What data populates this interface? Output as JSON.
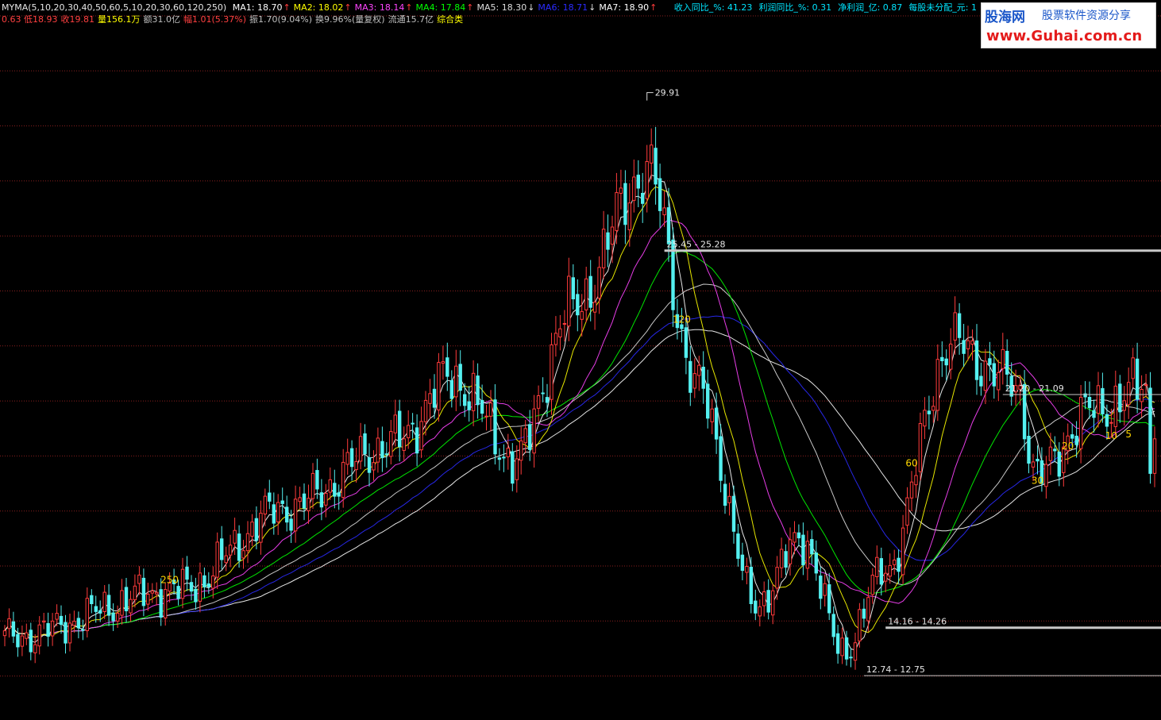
{
  "indicator_header": {
    "name": "MYMA(5,10,20,30,40,50,60,5,10,20,30,60,120,250)",
    "ma": [
      {
        "label": "MA1: 18.70",
        "color": "#ffffff",
        "arrow": "↑"
      },
      {
        "label": "MA2: 18.02",
        "color": "#ffff00",
        "arrow": "↑"
      },
      {
        "label": "MA3: 18.14",
        "color": "#ff44ff",
        "arrow": "↑"
      },
      {
        "label": "MA4: 17.84",
        "color": "#00ff00",
        "arrow": "↑"
      },
      {
        "label": "MA5: 18.30",
        "color": "#dddddd",
        "arrow": "↓"
      },
      {
        "label": "MA6: 18.71",
        "color": "#2b2bff",
        "arrow": "↓"
      },
      {
        "label": "MA7: 18.90",
        "color": "#ffffff",
        "arrow": "↑"
      }
    ]
  },
  "quote_line": {
    "items": [
      {
        "text": "0.63 低18.93",
        "color": "#ff4040"
      },
      {
        "text": "收19.81",
        "color": "#ff4040"
      },
      {
        "text": "量156.1万",
        "color": "#ffff00"
      },
      {
        "text": "额31.0亿",
        "color": "#c0c0c0"
      },
      {
        "text": "幅1.01(5.37%)",
        "color": "#ff4040"
      },
      {
        "text": "振1.70(9.04%)",
        "color": "#c0c0c0"
      },
      {
        "text": "换9.96%(量复权)",
        "color": "#c0c0c0"
      },
      {
        "text": "流通15.7亿",
        "color": "#c0c0c0"
      },
      {
        "text": "综合类",
        "color": "#ffff00"
      }
    ]
  },
  "fundamentals": [
    {
      "text": "收入同比_%: 41.23"
    },
    {
      "text": "利润同比_%: 0.31"
    },
    {
      "text": "净利润_亿: 0.87"
    },
    {
      "text": "每股未分配_元: 1"
    }
  ],
  "logo": {
    "brand": "股海网",
    "tagline": "股票软件资源分享",
    "url": "www.Guhai.com.cn"
  },
  "colors": {
    "background": "#000000",
    "gridline": "#8a1f1f",
    "up_candle": "#ff3b3b",
    "down_candle": "#54f0f0",
    "support_line": "#c8c8c8",
    "cycle_label": "#ffd700",
    "price_label": "#e6e6e6"
  },
  "chart_data": {
    "type": "candlestick",
    "title": "",
    "ylim": [
      12.0,
      31.8
    ],
    "grid": "horizontal dotted",
    "high_marker": {
      "label": "29.91",
      "index": 148,
      "value": 29.91
    },
    "price_ranges": [
      {
        "label": "25.45 - 25.28",
        "value": 25.3,
        "start_index": 152,
        "bold": true
      },
      {
        "label": "21.20 - 21.09",
        "value": 21.1,
        "start_index": 230,
        "bold": false
      },
      {
        "label": "14.16 - 14.26",
        "value": 14.3,
        "start_index": 203,
        "bold": true
      },
      {
        "label": "12.74 - 12.75",
        "value": 12.9,
        "start_index": 198,
        "bold": false
      }
    ],
    "cycle_labels": [
      {
        "text": "250",
        "index": 38,
        "value": 15.6
      },
      {
        "text": "120",
        "index": 156,
        "value": 23.2
      },
      {
        "text": "60",
        "index": 209,
        "value": 19.0
      },
      {
        "text": "30",
        "index": 238,
        "value": 18.5
      },
      {
        "text": "20",
        "index": 245,
        "value": 19.5
      },
      {
        "text": "10",
        "index": 255,
        "value": 19.8
      },
      {
        "text": "5",
        "index": 259,
        "value": 19.85
      }
    ],
    "key_prices": [
      {
        "index": 0,
        "value": 14.0
      },
      {
        "index": 40,
        "value": 15.4
      },
      {
        "index": 65,
        "value": 17.8
      },
      {
        "index": 90,
        "value": 19.7
      },
      {
        "index": 103,
        "value": 21.6
      },
      {
        "index": 118,
        "value": 19.2
      },
      {
        "index": 130,
        "value": 23.5
      },
      {
        "index": 148,
        "value": 27.6
      },
      {
        "index": 160,
        "value": 21.2
      },
      {
        "index": 173,
        "value": 15.0
      },
      {
        "index": 184,
        "value": 16.9
      },
      {
        "index": 193,
        "value": 13.6
      },
      {
        "index": 203,
        "value": 16.0
      },
      {
        "index": 218,
        "value": 22.6
      },
      {
        "index": 233,
        "value": 21.4
      },
      {
        "index": 238,
        "value": 18.7
      },
      {
        "index": 250,
        "value": 20.6
      },
      {
        "index": 263,
        "value": 21.3
      }
    ],
    "moving_averages": [
      {
        "name": "MA1",
        "period": 5,
        "color": "#ffffff"
      },
      {
        "name": "MA2",
        "period": 10,
        "color": "#ffff00"
      },
      {
        "name": "MA3",
        "period": 20,
        "color": "#ff44ff"
      },
      {
        "name": "MA4",
        "period": 30,
        "color": "#00ff00"
      },
      {
        "name": "MA5",
        "period": 40,
        "color": "#dddddd"
      },
      {
        "name": "MA6",
        "period": 50,
        "color": "#2b2bff"
      },
      {
        "name": "MA7",
        "period": 60,
        "color": "#ffffff"
      }
    ]
  }
}
